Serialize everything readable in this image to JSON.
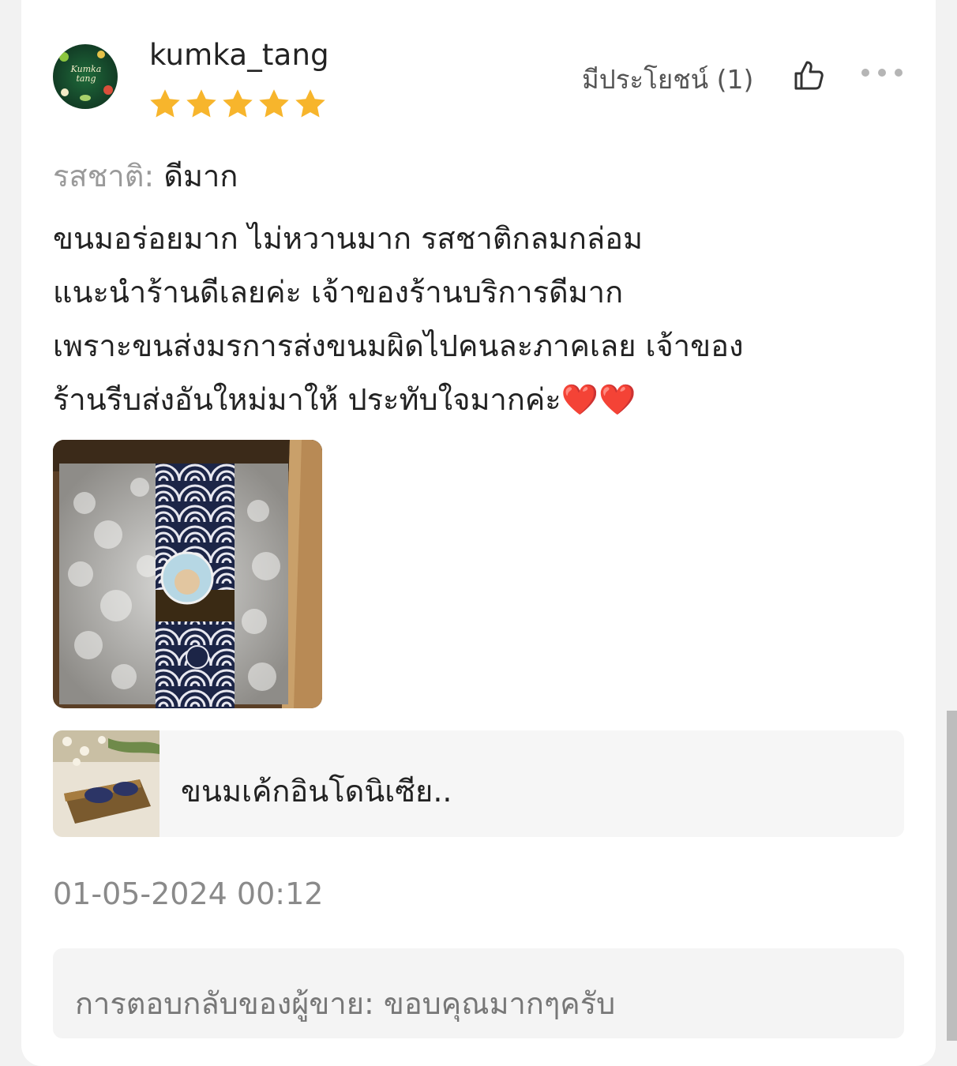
{
  "review": {
    "username": "kumka_tang",
    "avatar_text": "Kumka tang",
    "rating": 5,
    "rating_max": 5,
    "helpful_label": "มีประโยชน์ (1)",
    "attribute_label": "รสชาติ:",
    "attribute_value": "ดีมาก",
    "text_lines": [
      "ขนมอร่อยมาก ไม่หวานมาก รสชาติกลมกล่อม",
      "แนะนำร้านดีเลยค่ะ เจ้าของร้านบริการดีมาก",
      "เพราะขนส่งมรการส่งขนมผิดไปคนละภาคเลย เจ้าของ",
      "ร้านรีบส่งอันใหม่มาให้ ประทับใจมากค่ะ"
    ],
    "text_emoji": "❤️❤️",
    "product_name": "ขนมเค้กอินโดนิเซีย..",
    "timestamp": "01-05-2024 00:12",
    "seller_reply": "การตอบกลับของผู้ขาย: ขอบคุณมากๆครับ"
  },
  "icons": {
    "thumb": "thumbs-up-icon",
    "more": "more-horizontal-icon",
    "star": "star-icon"
  },
  "colors": {
    "star": "#f7b52c",
    "heart": "#e03b3b",
    "text": "#222222",
    "muted": "#9a9a9a"
  }
}
